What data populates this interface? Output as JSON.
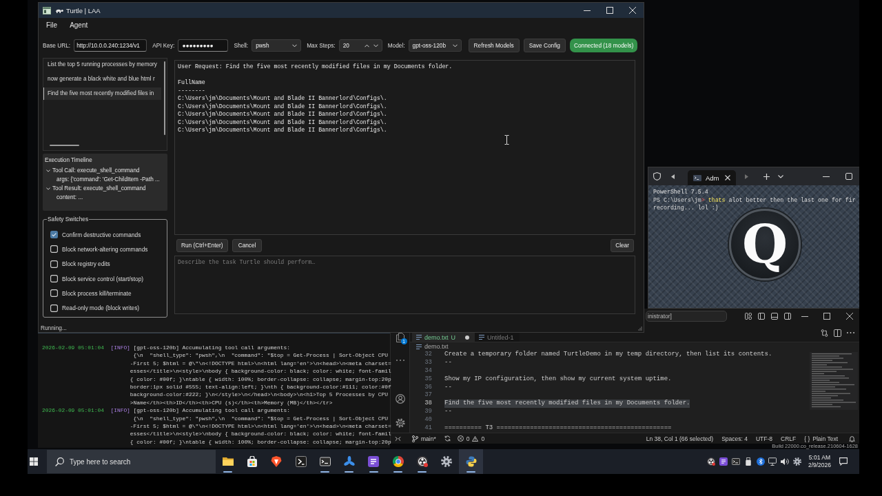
{
  "turtle_window": {
    "title": "Turtle | LAA",
    "menu": [
      "File",
      "Agent"
    ],
    "config": {
      "base_url": {
        "label": "Base URL:",
        "value": "http://10.0.0.240:1234/v1"
      },
      "api_key": {
        "label": "API Key:",
        "value": "●●●●●●●●●"
      },
      "shell": {
        "label": "Shell:",
        "value": "pwsh"
      },
      "max_steps": {
        "label": "Max Steps:",
        "value": "20"
      },
      "model": {
        "label": "Model:",
        "value": "gpt-oss-120b"
      },
      "buttons": [
        "Refresh Models",
        "Save Config"
      ],
      "connection": {
        "text": "Connected (18 models)",
        "connected": true
      }
    },
    "history": [
      {
        "text": "List the top 5 running processes by memory",
        "selected": false
      },
      {
        "text": "now generate a black white and blue html r",
        "selected": false
      },
      {
        "text": "Find the five most recently modified files in",
        "selected": true
      }
    ],
    "timeline": {
      "title": "Execution Timeline",
      "items": [
        {
          "text": "Tool Call: execute_shell_command",
          "expanded": true,
          "children": [
            {
              "text": "args: {'command': 'Get-ChildItem -Path ..."
            }
          ]
        },
        {
          "text": "Tool Result: execute_shell_command",
          "expanded": true,
          "children": [
            {
              "text": "content: ..."
            }
          ]
        }
      ]
    },
    "safety": {
      "title": "Safety Switches",
      "switches": [
        {
          "label": "Confirm destructive commands",
          "checked": true
        },
        {
          "label": "Block network-altering commands",
          "checked": false
        },
        {
          "label": "Block registry edits",
          "checked": false
        },
        {
          "label": "Block service control (start/stop)",
          "checked": false
        },
        {
          "label": "Block process kill/terminate",
          "checked": false
        },
        {
          "label": "Read-only mode (block writes)",
          "checked": false
        }
      ]
    },
    "output": {
      "blocks": [
        {
          "lines": [
            "User Request: Find the five most recently modified files in my Documents folder."
          ]
        },
        {
          "lines": [
            "FullName",
            "--------",
            "C:\\Users\\jm\\Documents\\Mount and Blade II Bannerlord\\Configs\\.",
            "C:\\Users\\jm\\Documents\\Mount and Blade II Bannerlord\\Configs\\.",
            "C:\\Users\\jm\\Documents\\Mount and Blade II Bannerlord\\Configs\\.",
            "C:\\Users\\jm\\Documents\\Mount and Blade II Bannerlord\\Configs\\.",
            "C:\\Users\\jm\\Documents\\Mount and Blade II Bannerlord\\Configs\\."
          ]
        }
      ]
    },
    "actions": [
      "Run (Ctrl+Enter)",
      "Cancel"
    ],
    "clear_button": "Clear",
    "task_input": {
      "placeholder": "Describe the task Turtle should perform…"
    },
    "status": "Running..."
  },
  "terminal_window": {
    "tab_title": "Adm",
    "lines": [
      {
        "segments": [
          {
            "kind": "output",
            "text": "PowerShell 7.5.4"
          }
        ]
      },
      {
        "segments": [
          {
            "kind": "prompt",
            "text": "PS C:\\Users\\jm"
          },
          {
            "kind": "prompt_mark",
            "text": ">"
          },
          {
            "kind": "command",
            "text": " thats"
          },
          {
            "kind": "argument",
            "text": " alot better then the last one for fir"
          }
        ]
      },
      {
        "segments": [
          {
            "kind": "argument",
            "text": "recording... lol :)"
          }
        ]
      }
    ],
    "background_logo": "Q"
  },
  "log_window": {
    "entries": [
      {
        "timestamp": "2026-02-09 05:01:04",
        "level": "[INFO]",
        "message": "[gpt-oss-120b] Accumulating tool call arguments:",
        "details": [
          " {\\n  \"shell_type\": \"pwsh\",\\n  \"command\": \"$top = Get-Process | Sort-Object CPU",
          "-First 5; $html = @\\\"\\n<!DOCTYPE html>\\n<html lang='en'>\\n<head>\\n<meta charset=",
          "esses</title>\\n<style>\\nbody { background-color: black; color: white; font-famil",
          "{ color: #00f; }\\ntable { width: 100%; border-collapse: collapse; margin-top:20p",
          "border:1px solid #555; text-align:left; }\\nth { background-color:#111; color:#0f",
          "background-color:#222; }\\n</style>\\n</head>\\n<body>\\n<h1>Top 5 Processes by CPU",
          ">Name</th><th>ID</th><th>CPU (s)</th><th>Memory (MB)</th></tr>"
        ]
      },
      {
        "timestamp": "2026-02-09 05:01:04",
        "level": "[INFO]",
        "message": "[gpt-oss-120b] Accumulating tool call arguments:",
        "details": [
          " {\\n  \"shell_type\": \"pwsh\",\\n  \"command\": \"$top = Get-Process | Sort-Object CPU",
          "-First 5; $html = @\\\"\\n<!DOCTYPE html>\\n<html lang='en'>\\n<head>\\n<meta charset=",
          "esses</title>\\n<style>\\nbody { background-color: black; color: white; font-famil",
          "{ color: #00f; }\\ntable { width: 100%; border-collapse: collapse; margin-top:20p"
        ]
      }
    ]
  },
  "editor_window": {
    "search": "inistrator]",
    "explorer_badge": "1",
    "tabs": [
      {
        "label": "demo.txt",
        "git_status": "U",
        "modified": true,
        "selected": true
      },
      {
        "label": "Untitled-1",
        "modified": false,
        "selected": false
      }
    ],
    "breadcrumb": "demo.txt",
    "lines": [
      {
        "number": "32",
        "text": "Create a temporary folder named TurtleDemo in my temp directory, then list its contents.",
        "selected": false
      },
      {
        "number": "33",
        "text": "--",
        "selected": false
      },
      {
        "number": "34",
        "selected": false
      },
      {
        "number": "35",
        "text": "Show my IP configuration, then show my current system uptime.",
        "selected": false
      },
      {
        "number": "36",
        "text": "--",
        "selected": false
      },
      {
        "number": "37",
        "selected": false
      },
      {
        "number": "38",
        "text": "Find the five most recently modified files in my Documents folder.",
        "selected": true
      },
      {
        "number": "39",
        "text": "--",
        "selected": false
      },
      {
        "number": "40",
        "selected": false
      },
      {
        "number": "41",
        "text": "========== T3 ===============================================",
        "selected": false
      }
    ],
    "status_bar": {
      "branch": "main*",
      "errors": "0",
      "warnings": "0",
      "items": [
        {
          "text": "Ln 38, Col 1 (66 selected)"
        },
        {
          "text": "Spaces: 4"
        },
        {
          "text": "UTF-8"
        },
        {
          "text": "CRLF"
        },
        {
          "prefix": "{ }",
          "text": "Plain Text"
        }
      ]
    }
  },
  "desktop": {
    "build_text": "Build 22000.co_release.210604-1628"
  },
  "taskbar": {
    "search_placeholder": "Type here to search",
    "apps": [
      {
        "kind": "folder",
        "running": true,
        "selected": false
      },
      {
        "kind": "store",
        "running": false,
        "selected": false
      },
      {
        "kind": "lion",
        "running": false,
        "selected": false
      },
      {
        "kind": "powershell",
        "running": false,
        "selected": false
      },
      {
        "kind": "terminal",
        "running": true,
        "selected": false
      },
      {
        "kind": "ribbon",
        "running": true,
        "selected": false
      },
      {
        "kind": "notes",
        "running": true,
        "selected": false
      },
      {
        "kind": "chrome",
        "running": true,
        "selected": false
      },
      {
        "kind": "obs",
        "running": true,
        "selected": false
      },
      {
        "kind": "gear",
        "running": false,
        "selected": false
      },
      {
        "kind": "python",
        "running": true,
        "selected": true
      }
    ],
    "tray": [
      {
        "kind": "obs"
      },
      {
        "kind": "notes"
      },
      {
        "kind": "terminal"
      },
      {
        "kind": "usb"
      },
      {
        "kind": "bluetooth"
      },
      {
        "kind": "network"
      },
      {
        "kind": "volume"
      },
      {
        "kind": "gear"
      }
    ],
    "clock": {
      "time": "5:01 AM",
      "date": "2/9/2026"
    }
  }
}
